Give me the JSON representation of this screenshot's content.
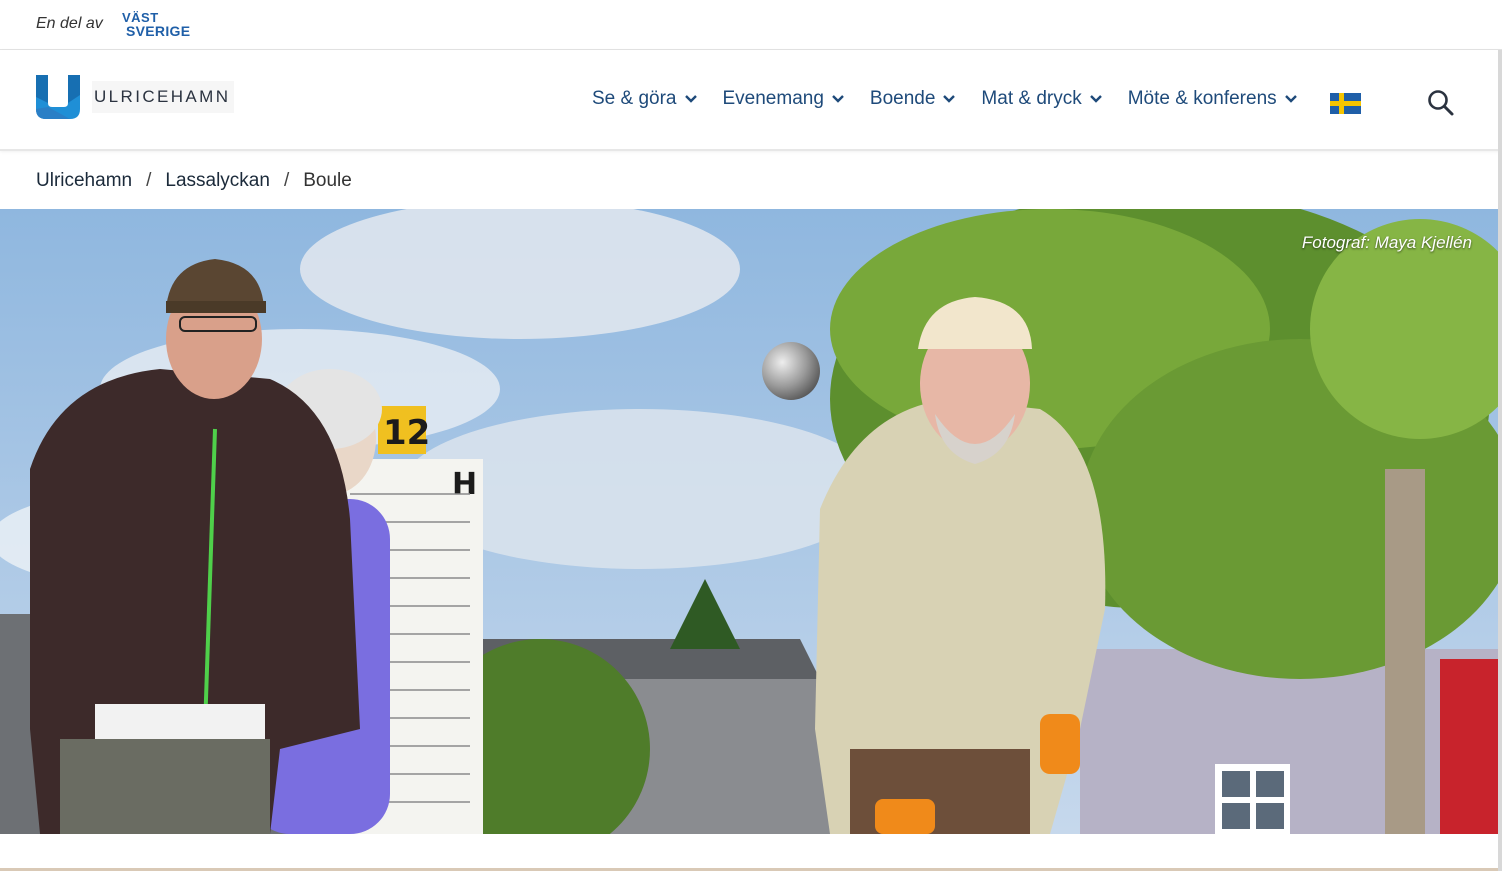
{
  "topbar": {
    "part_of": "En del av",
    "partner_logo_top": "VÄST",
    "partner_logo_bottom": "SVERIGE"
  },
  "header": {
    "brand_name": "ULRICEHAMN",
    "nav": [
      {
        "label": "Se & göra"
      },
      {
        "label": "Evenemang"
      },
      {
        "label": "Boende"
      },
      {
        "label": "Mat & dryck"
      },
      {
        "label": "Möte & konferens"
      }
    ],
    "language_flag": "swedish-flag-icon",
    "search_icon": "search-icon"
  },
  "breadcrumb": {
    "items": [
      "Ulricehamn",
      "Lassalyckan"
    ],
    "current": "Boule",
    "separator": "/"
  },
  "hero": {
    "photo_credit": "Fotograf: Maya Kjellén",
    "scoreboard_number": "12",
    "scoreboard_letter": "H"
  },
  "colors": {
    "nav_text": "#1e4a7a",
    "brand_blue": "#1f8fd6",
    "flag_blue": "#1f5fa8",
    "flag_yellow": "#f5c400"
  }
}
